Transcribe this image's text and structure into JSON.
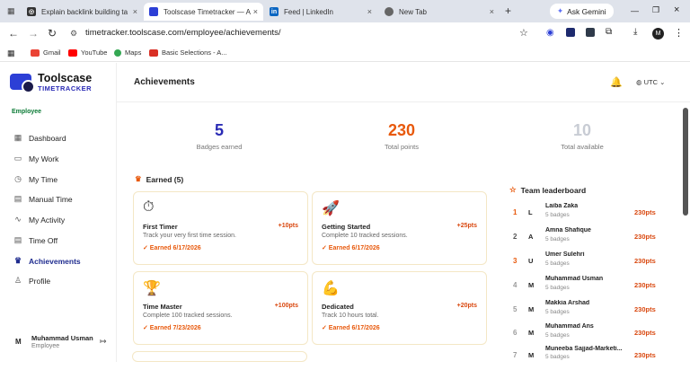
{
  "browser": {
    "tabs": [
      {
        "label": "Explain backlink building ta",
        "active": false
      },
      {
        "label": "Toolscase Timetracker — A",
        "active": true
      },
      {
        "label": "Feed | LinkedIn",
        "active": false
      },
      {
        "label": "New Tab",
        "active": false
      }
    ],
    "new_tab": "+",
    "gemini": "Ask Gemini",
    "url": "timetracker.toolscase.com/employee/achievements/",
    "bookmarks": [
      "Gmail",
      "YouTube",
      "Maps",
      "Basic Selections - A..."
    ],
    "profile_initial": "M"
  },
  "sidebar": {
    "brand": "Toolscase",
    "brand_sub": "TIMETRACKER",
    "section": "Employee",
    "items": [
      {
        "label": "Dashboard",
        "icon": "grid-icon"
      },
      {
        "label": "My Work",
        "icon": "folder-icon"
      },
      {
        "label": "My Time",
        "icon": "clock-icon"
      },
      {
        "label": "Manual Time",
        "icon": "calendar-icon"
      },
      {
        "label": "My Activity",
        "icon": "activity-icon"
      },
      {
        "label": "Time Off",
        "icon": "calendar-icon"
      },
      {
        "label": "Achievements",
        "icon": "trophy-icon"
      },
      {
        "label": "Profile",
        "icon": "user-icon"
      }
    ],
    "user": {
      "initial": "M",
      "name": "Muhammad Usman",
      "role": "Employee"
    }
  },
  "header": {
    "title": "Achievements",
    "timezone": "UTC"
  },
  "stats": [
    {
      "value": "5",
      "label": "Badges earned",
      "color": "#2a2bb5"
    },
    {
      "value": "230",
      "label": "Total points",
      "color": "#e8590c"
    },
    {
      "value": "10",
      "label": "Total available",
      "color": "#c8ccd4"
    }
  ],
  "earned": {
    "heading": "Earned (5)",
    "cards": [
      {
        "title": "First Timer",
        "desc": "Track your very first time session.",
        "points": "+10pts",
        "earned": "✓ Earned 6/17/2026",
        "icon": "stopwatch-icon"
      },
      {
        "title": "Getting Started",
        "desc": "Complete 10 tracked sessions.",
        "points": "+25pts",
        "earned": "✓ Earned 6/17/2026",
        "icon": "rocket-icon"
      },
      {
        "title": "Time Master",
        "desc": "Complete 100 tracked sessions.",
        "points": "+100pts",
        "earned": "✓ Earned 7/23/2026",
        "icon": "trophy-icon"
      },
      {
        "title": "Dedicated",
        "desc": "Track 10 hours total.",
        "points": "+20pts",
        "earned": "✓ Earned 6/17/2026",
        "icon": "muscle-icon"
      }
    ]
  },
  "leaderboard": {
    "heading": "Team leaderboard",
    "rows": [
      {
        "rank": "1",
        "initial": "L",
        "name": "Laiba Zaka",
        "badges": "5 badges",
        "points": "230pts"
      },
      {
        "rank": "2",
        "initial": "A",
        "name": "Amna Shafique",
        "badges": "5 badges",
        "points": "230pts"
      },
      {
        "rank": "3",
        "initial": "U",
        "name": "Umer Sulehri",
        "badges": "5 badges",
        "points": "230pts"
      },
      {
        "rank": "4",
        "initial": "M",
        "name": "Muhammad Usman",
        "badges": "5 badges",
        "points": "230pts"
      },
      {
        "rank": "5",
        "initial": "M",
        "name": "Makkia Arshad",
        "badges": "5 badges",
        "points": "230pts"
      },
      {
        "rank": "6",
        "initial": "M",
        "name": "Muhammad Ans",
        "badges": "5 badges",
        "points": "230pts"
      },
      {
        "rank": "7",
        "initial": "M",
        "name": "Muneeba Sajjad-Marketi...",
        "badges": "5 badges",
        "points": "230pts"
      }
    ]
  },
  "colors": {
    "brand": "#2a2bb5",
    "accent": "#e8590c",
    "section": "#0a7a35"
  }
}
